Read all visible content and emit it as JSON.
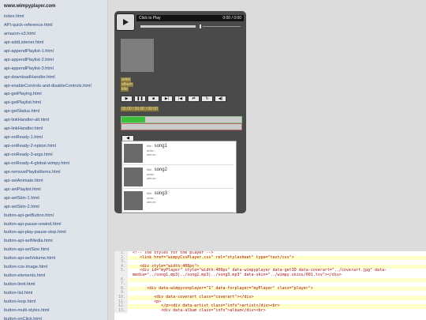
{
  "sidebar": {
    "site": "www.wimpyplayer.com",
    "items": [
      "index.html",
      "API-quick-reference.html",
      "amazon-s3.html",
      "api-addListener.html",
      "api-appendPlaylist-1.html",
      "api-appendPlaylist-2.html",
      "api-appendPlaylist-3.html",
      "api-downloadHandler.html",
      "api-enableControls-and-disableControls.html",
      "api-getPlaying.html",
      "api-getPlaylist.html",
      "api-getStatus.html",
      "api-linkHandler-alt.html",
      "api-linkHandler.html",
      "api-onReady-1.html",
      "api-onReady-2-option.html",
      "api-onReady-3-args.html",
      "api-onReady-4-global-wimpy.html",
      "api-removePlaylistItems.html",
      "api-setAnimate.html",
      "api-setPlaylist.html",
      "api-setSkin-1.html",
      "api-setSkin-2.html",
      "button-api-getButton.html",
      "button-api-pause-rewind.html",
      "button-api-play-pause-stop.html",
      "button-api-setMedia.html",
      "button-api-setSize.html",
      "button-api-setVolume.html",
      "button-css-image.html",
      "button-elements.html",
      "button-limit.html",
      "button-list.html",
      "button-loop.html",
      "button-multi-styles.html",
      "button-onClick.html"
    ]
  },
  "player": {
    "title": "Click to Play",
    "time": "0:00 / 0:00",
    "artist": "artist",
    "album": "album",
    "title_tag": "title",
    "controls": [
      "▶",
      "❚❚",
      "■",
      "▶|",
      "|◀",
      "⇄",
      "↻",
      "◀)"
    ],
    "timeinfo": "00:00 / 00:00 / 00:00",
    "load_fraction": 0.2,
    "play_fraction": 0,
    "playlist_toggle": "◀",
    "playlist": [
      {
        "title_label": "title :",
        "song": "song1",
        "artist_label": "artist :",
        "album_label": "album :"
      },
      {
        "title_label": "title :",
        "song": "song2",
        "artist_label": "artist :",
        "album_label": "album :"
      },
      {
        "title_label": "title :",
        "song": "song3",
        "artist_label": "artist :",
        "album_label": "album :"
      }
    ]
  },
  "code": [
    {
      "n": "1.",
      "t": "<!-- The styles for the player -->"
    },
    {
      "n": "2.",
      "t": "   <link href=\"wimpyCssPlayer.css\" rel=\"stylesheet\" type=\"text/css\">"
    },
    {
      "n": "3.",
      "t": ""
    },
    {
      "n": "4.",
      "t": "   <div style=\"width:400px\">"
    },
    {
      "n": "5.",
      "t": "   <div id=\"myPlayer\" style=\"width:400px\" data-wimpyplayer data-getID data-coverart=\"../coverart.jpg\" data-media=\"../song1.mp3|../song2.mp3|../song3.mp3\" data-skin=\"../wimpy.skins/001.tsv\"></div>"
    },
    {
      "n": "6.",
      "t": ""
    },
    {
      "n": "7.",
      "t": ""
    },
    {
      "n": "8.",
      "t": "      <div data-wimpyconplayer=\"1\" data-forplayer=\"myPlayer\" class=\"player\">"
    },
    {
      "n": "9.",
      "t": ""
    },
    {
      "n": "10.",
      "t": "         <div data-coverart class=\"coverart\"></div>"
    },
    {
      "n": "11.",
      "t": "         <p>"
    },
    {
      "n": "12.",
      "t": "            </p><div data-artist class=\"info\">artist</div><br>"
    },
    {
      "n": "13.",
      "t": "            <div data-album class=\"info\">album</div><br>"
    }
  ]
}
